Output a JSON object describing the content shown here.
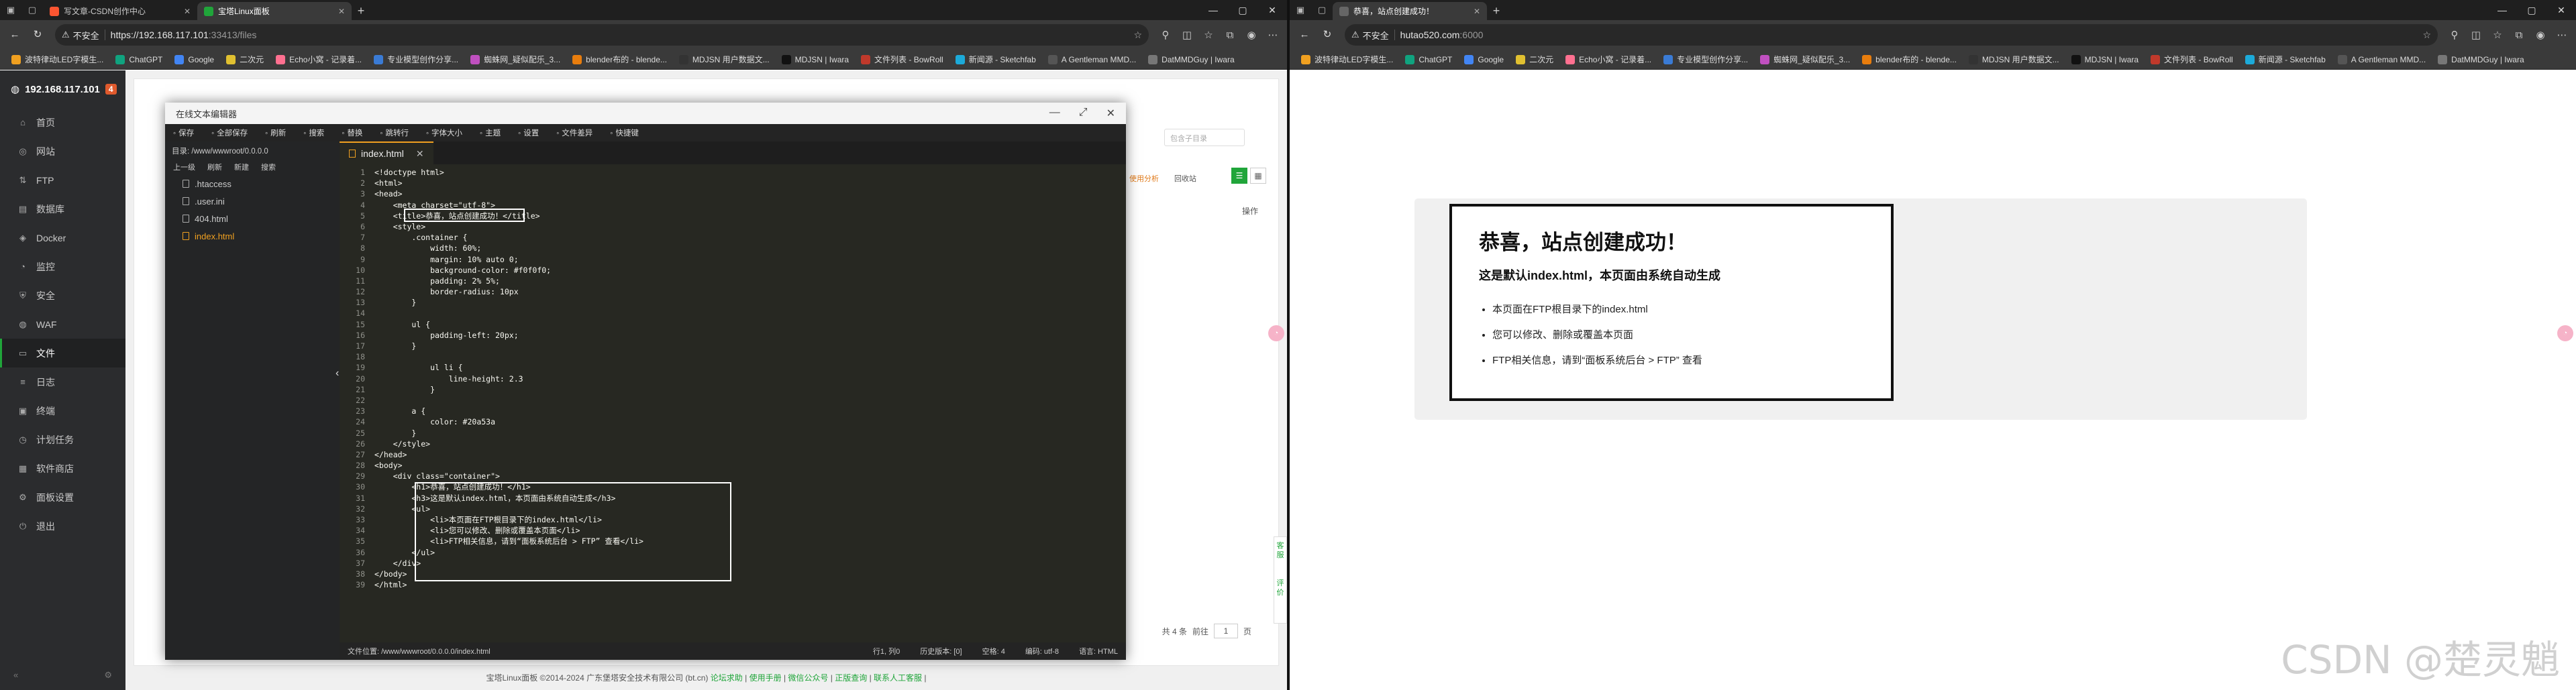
{
  "left": {
    "tabs": [
      {
        "title": "写文章-CSDN创作中心",
        "active": false,
        "color": "#fc5531"
      },
      {
        "title": "宝塔Linux面板",
        "active": true,
        "color": "#20a53a"
      }
    ],
    "omnibox": {
      "security": "不安全",
      "scheme": "https://",
      "host": "192.168.117.101",
      "rest": ":33413/files"
    },
    "bookmarks": [
      "波特律动LED字模生...",
      "ChatGPT",
      "Google",
      "二次元",
      "Echo小窝 - 记录着...",
      "专业模型创作分享...",
      "蜘蛛网_疑似配乐_3...",
      "blender布的 - blende...",
      "MDJSN 用户数据文...",
      "MDJSN | Iwara",
      "文件列表 - BowRoll",
      "新闻源 - Sketchfab",
      "A Gentleman MMD...",
      "DatMMDGuy | Iwara"
    ],
    "sidebar": {
      "host": "192.168.117.101",
      "badge": "4",
      "items": [
        {
          "label": "首页",
          "icon": "⌂"
        },
        {
          "label": "网站",
          "icon": "◎"
        },
        {
          "label": "FTP",
          "icon": "⇅"
        },
        {
          "label": "数据库",
          "icon": "▤"
        },
        {
          "label": "Docker",
          "icon": "◈"
        },
        {
          "label": "监控",
          "icon": "◔"
        },
        {
          "label": "安全",
          "icon": "⛨"
        },
        {
          "label": "WAF",
          "icon": "◍"
        },
        {
          "label": "文件",
          "icon": "▭",
          "active": true
        },
        {
          "label": "日志",
          "icon": "≡"
        },
        {
          "label": "终端",
          "icon": "▣"
        },
        {
          "label": "计划任务",
          "icon": "◷"
        },
        {
          "label": "软件商店",
          "icon": "▦"
        },
        {
          "label": "面板设置",
          "icon": "⚙"
        },
        {
          "label": "退出",
          "icon": "⏻"
        }
      ]
    },
    "panel": {
      "search_placeholder": "包含子目录",
      "check_label": "使用分析",
      "recycle_label": "回收站",
      "col_ops": "操作",
      "pager_total": "共 4 条",
      "pager_go": "前往",
      "pager_page": "1",
      "pager_unit": "页",
      "footer": "宝塔Linux面板 ©2014-2024 广东堡塔安全技术有限公司 (bt.cn)",
      "footer_links": [
        "论坛求助",
        "使用手册",
        "微信公众号",
        "正版查询",
        "联系人工客服"
      ],
      "help_widget": "客服",
      "eval_widget": "评价"
    },
    "editor": {
      "title": "在线文本编辑器",
      "toolbar": [
        "保存",
        "全部保存",
        "刷新",
        "搜索",
        "替换",
        "跳转行",
        "字体大小",
        "主题",
        "设置",
        "文件差异",
        "快捷键"
      ],
      "dir_label": "目录: /www/wwwroot/0.0.0.0",
      "ops": [
        "上一级",
        "刷新",
        "新建",
        "搜索"
      ],
      "files": [
        {
          "name": ".htaccess",
          "active": false
        },
        {
          "name": ".user.ini",
          "active": false
        },
        {
          "name": "404.html",
          "active": false
        },
        {
          "name": "index.html",
          "active": true
        }
      ],
      "tab": "index.html",
      "status": {
        "path": "文件位置: /www/wwwroot/0.0.0.0/index.html",
        "pos": "行1, 列0",
        "history": "历史版本: [0]",
        "indent": "空格: 4",
        "encoding": "编码: utf-8",
        "lang": "语言: HTML"
      },
      "code": [
        "<!doctype html>",
        "<html>",
        "<head>",
        "    <meta charset=\"utf-8\">",
        "    <title>恭喜，站点创建成功！</title>",
        "    <style>",
        "        .container {",
        "            width: 60%;",
        "            margin: 10% auto 0;",
        "            background-color: #f0f0f0;",
        "            padding: 2% 5%;",
        "            border-radius: 10px",
        "        }",
        "",
        "        ul {",
        "            padding-left: 20px;",
        "        }",
        "",
        "            ul li {",
        "                line-height: 2.3",
        "            }",
        "",
        "        a {",
        "            color: #20a53a",
        "        }",
        "    </style>",
        "</head>",
        "<body>",
        "    <div class=\"container\">",
        "        <h1>恭喜，站点创建成功！</h1>",
        "        <h3>这是默认index.html，本页面由系统自动生成</h3>",
        "        <ul>",
        "            <li>本页面在FTP根目录下的index.html</li>",
        "            <li>您可以修改、删除或覆盖本页面</li>",
        "            <li>FTP相关信息，请到“面板系统后台 > FTP” 查看</li>",
        "        </ul>",
        "    </div>",
        "</body>",
        "</html>"
      ]
    }
  },
  "right": {
    "tabs": [
      {
        "title": "恭喜，站点创建成功！",
        "active": true
      }
    ],
    "omnibox": {
      "security": "不安全",
      "host": "hutao520.com",
      "rest": ":6000"
    },
    "bookmarks": [
      "波特律动LED字模生...",
      "ChatGPT",
      "Google",
      "二次元",
      "Echo小窝 - 记录着...",
      "专业模型创作分享...",
      "蜘蛛网_疑似配乐_3...",
      "blender布的 - blende...",
      "MDJSN 用户数据文...",
      "MDJSN | Iwara",
      "文件列表 - BowRoll",
      "新闻源 - Sketchfab",
      "A Gentleman MMD...",
      "DatMMDGuy | Iwara"
    ],
    "page": {
      "h1": "恭喜，站点创建成功！",
      "h3": "这是默认index.html，本页面由系统自动生成",
      "items": [
        "本页面在FTP根目录下的index.html",
        "您可以修改、删除或覆盖本页面",
        "FTP相关信息，请到“面板系统后台 > FTP” 查看"
      ]
    },
    "watermark": "CSDN @楚灵魈"
  }
}
